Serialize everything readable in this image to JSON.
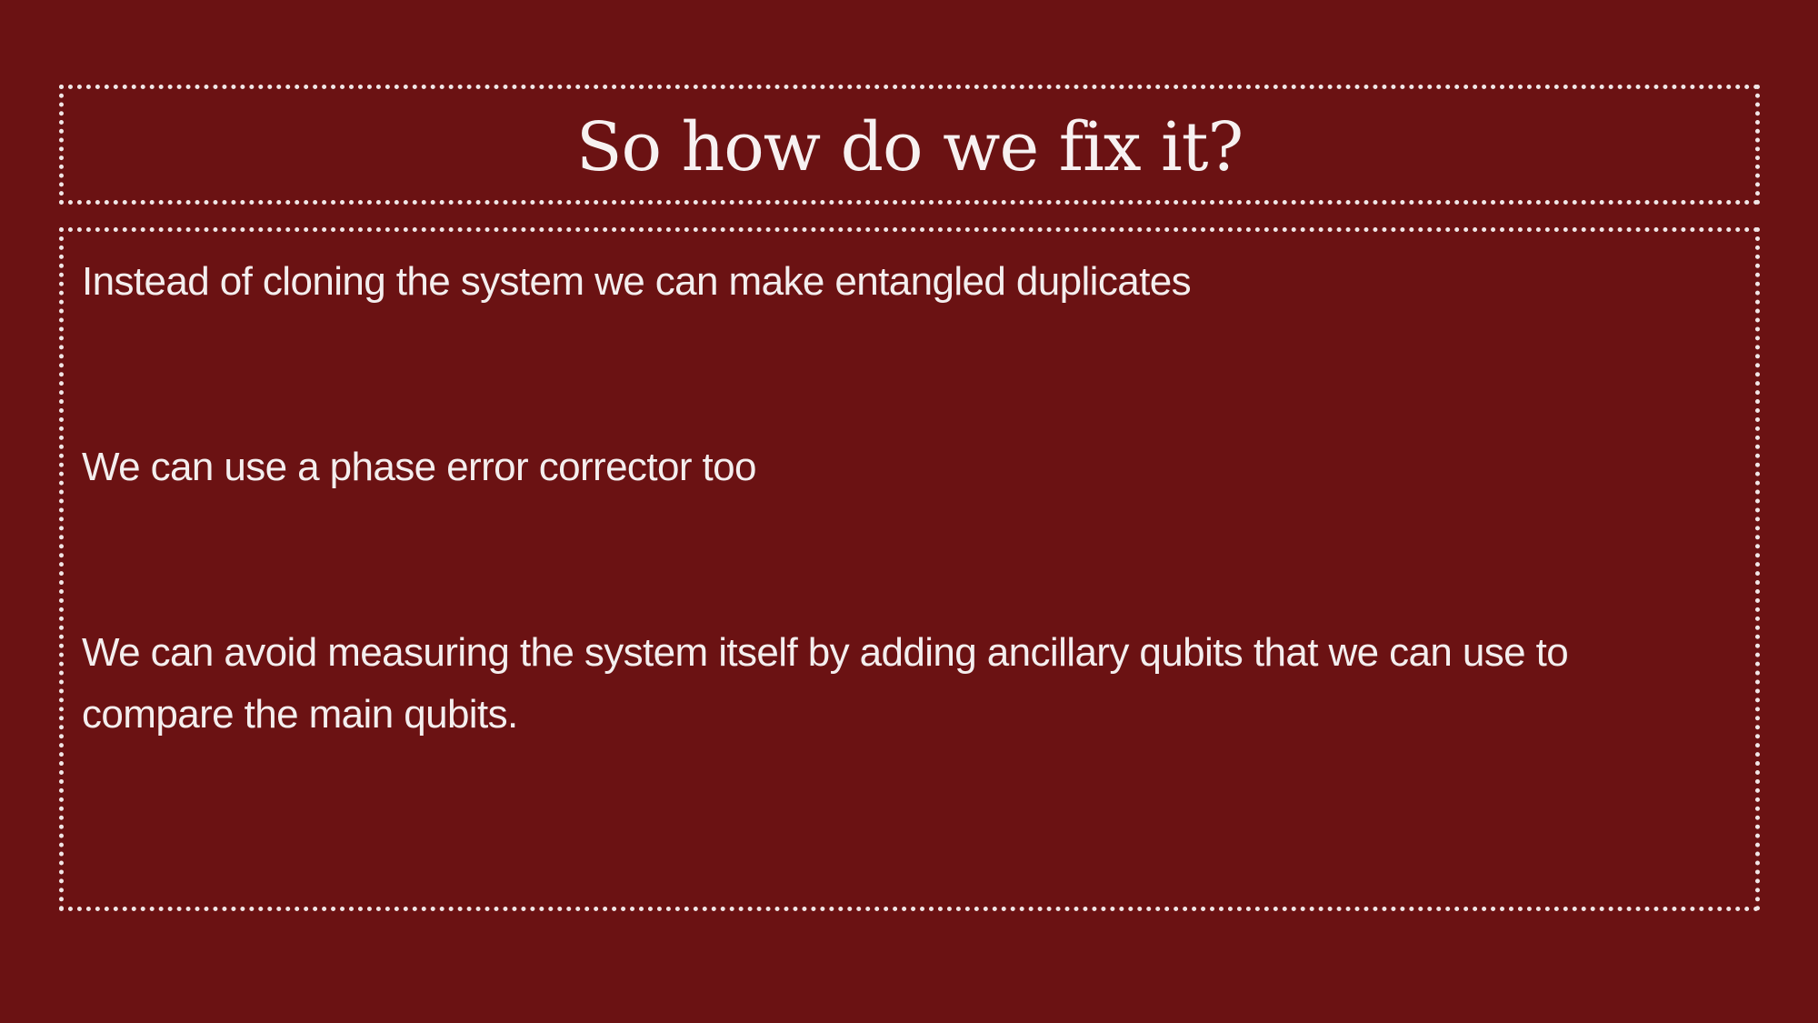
{
  "slide": {
    "title": "So how do we fix it?",
    "bullets": [
      "Instead of cloning the system we can make entangled duplicates",
      "We can use a phase error corrector too",
      "We can avoid measuring the system itself by adding ancillary qubits that we can use to compare the main qubits."
    ]
  },
  "colors": {
    "background": "#6b1213",
    "text": "#f4eeee",
    "frame": "#f1e6e6"
  }
}
